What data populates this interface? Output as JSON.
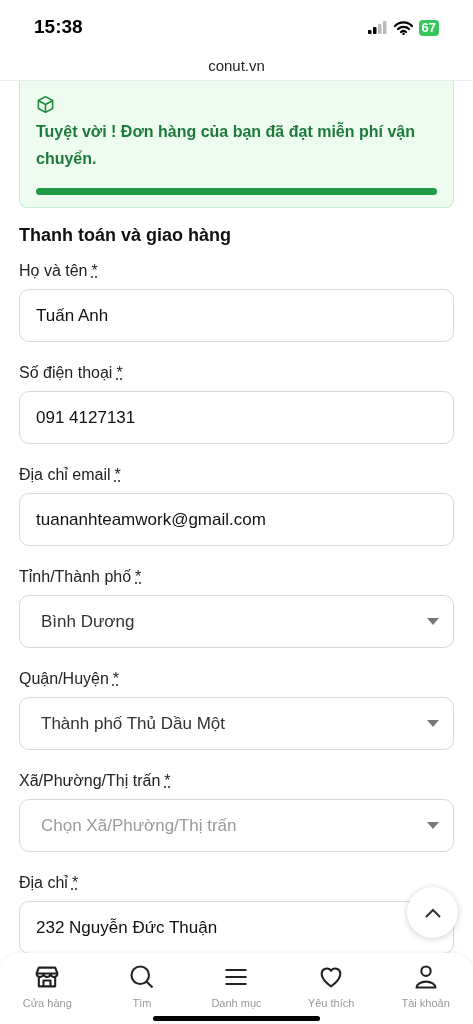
{
  "status_bar": {
    "time": "15:38",
    "battery": "67"
  },
  "address_bar": {
    "url": "conut.vn"
  },
  "notice": {
    "message": "Tuyệt vời ! Đơn hàng của bạn đã đạt miễn phí vận chuyển.",
    "level": 1
  },
  "section_title": "Thanh toán và giao hàng",
  "fields": [
    {
      "kind": "text",
      "label": "Họ và tên",
      "required_mark": "*",
      "value": "Tuấn Anh"
    },
    {
      "kind": "text",
      "label": "Số điện thoại",
      "required_mark": "*",
      "value": "091 4127131"
    },
    {
      "kind": "text",
      "label": "Địa chỉ email",
      "required_mark": "*",
      "value": "tuananhteamwork@gmail.com"
    },
    {
      "kind": "select",
      "label": "Tỉnh/Thành phố",
      "required_mark": "*",
      "value": "Bình Dương"
    },
    {
      "kind": "select",
      "label": "Quận/Huyện",
      "required_mark": "*",
      "value": "Thành phố Thủ Dầu Một"
    },
    {
      "kind": "select",
      "label": "Xã/Phường/Thị trấn",
      "required_mark": "*",
      "placeholder": "Chọn Xã/Phường/Thị trấn"
    },
    {
      "kind": "text",
      "label": "Địa chỉ",
      "required_mark": "*",
      "value": "232 Nguyễn Đức Thuận"
    }
  ],
  "bottom_nav": [
    {
      "label": "Cửa hàng"
    },
    {
      "label": "Tìm"
    },
    {
      "label": "Danh mục"
    },
    {
      "label": "Yêu thích"
    },
    {
      "label": "Tài khoản"
    }
  ]
}
